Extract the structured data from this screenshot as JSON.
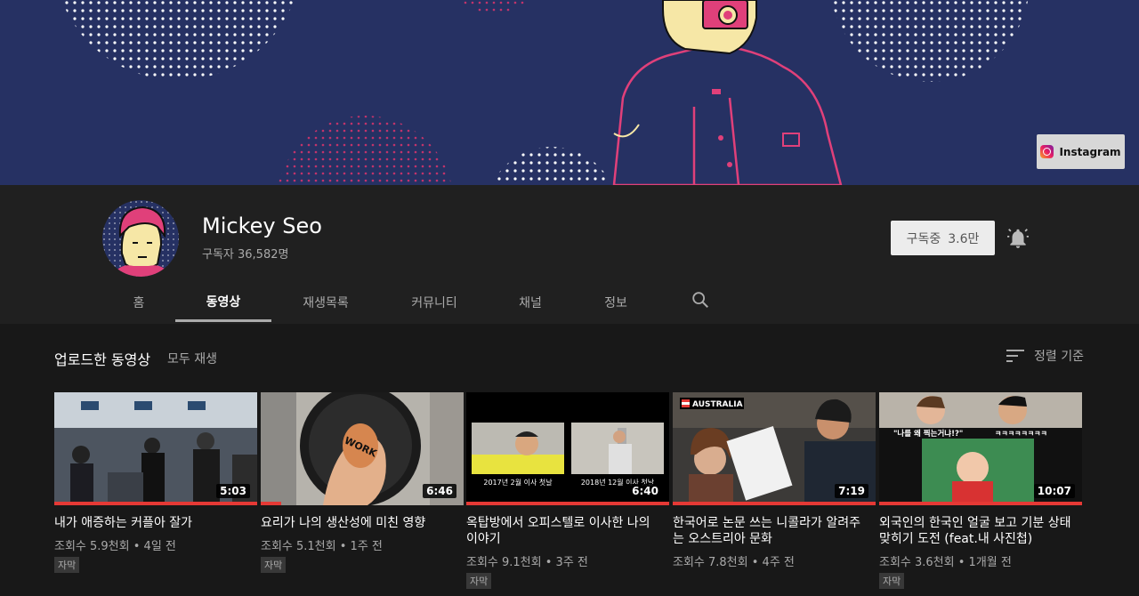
{
  "banner": {
    "instagram_label": "Instagram",
    "colors": {
      "background": "#263163",
      "accent": "#e0407a",
      "skin": "#f6e7a6"
    }
  },
  "channel": {
    "name": "Mickey Seo",
    "subscribers": "구독자 36,582명",
    "subscribe_label": "구독중",
    "subscribe_count": "3.6만"
  },
  "tabs": [
    {
      "label": "홈"
    },
    {
      "label": "동영상"
    },
    {
      "label": "재생목록"
    },
    {
      "label": "커뮤니티"
    },
    {
      "label": "채널"
    },
    {
      "label": "정보"
    }
  ],
  "section": {
    "title": "업로드한 동영상",
    "play_all": "모두 재생",
    "sort_label": "정렬 기준"
  },
  "videos": [
    {
      "title": "내가 애증하는 커플아 잘가",
      "views": "조회수 5.9천회",
      "age": "4일 전",
      "badge": "자막",
      "duration": "5:03",
      "progress": 1.0
    },
    {
      "title": "요리가 나의 생산성에 미친 영향",
      "views": "조회수 5.1천회",
      "age": "1주 전",
      "badge": "자막",
      "duration": "6:46",
      "progress": 0.1,
      "thumb_text": "WORK"
    },
    {
      "title": "옥탑방에서 오피스텔로 이사한 나의 이야기",
      "views": "조회수 9.1천회",
      "age": "3주 전",
      "badge": "자막",
      "duration": "6:40",
      "progress": 1.0,
      "caption_left": "2017년 2월 이사 첫날",
      "caption_right": "2018년 12월 이사 첫날"
    },
    {
      "title": "한국어로 논문 쓰는 니콜라가 알려주는 오스트리아 문화",
      "views": "조회수 7.8천회",
      "age": "4주 전",
      "badge": "",
      "duration": "7:19",
      "progress": 1.0,
      "thumb_text": "AUSTRALIA"
    },
    {
      "title": "외국인의 한국인 얼굴 보고 기분 상태 맞히기 도전 (feat.내 사진첩)",
      "views": "조회수 3.6천회",
      "age": "1개월 전",
      "badge": "자막",
      "duration": "10:07",
      "progress": 1.0,
      "thumb_text": "\"나를 왜 찍는거냐!?\"",
      "thumb_text2": "ㅋㅋㅋㅋㅋㅋㅋㅋ"
    }
  ]
}
